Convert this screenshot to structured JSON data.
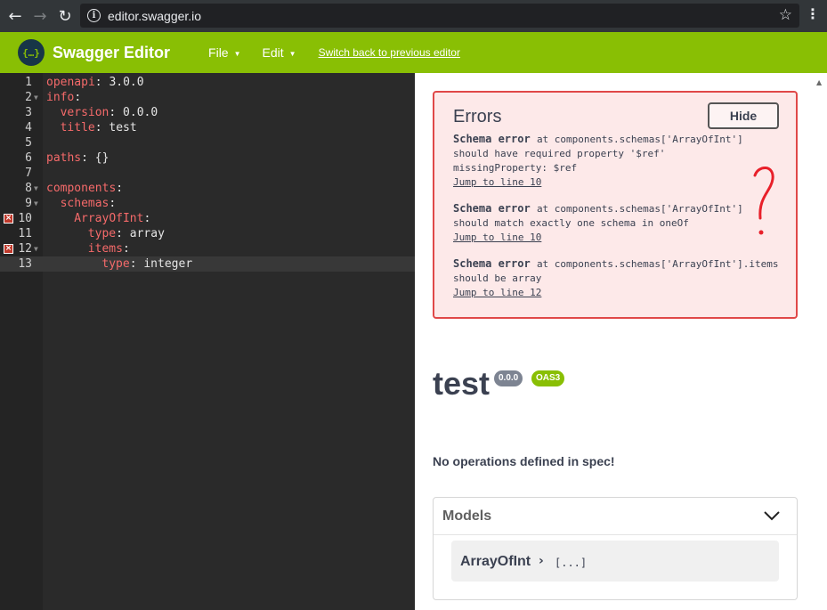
{
  "browser": {
    "url": "editor.swagger.io",
    "icons": {
      "back": "back-arrow-icon",
      "forward": "forward-arrow-icon",
      "reload": "reload-icon",
      "info": "info-icon",
      "star": "bookmark-star-icon",
      "menu": "browser-menu-icon"
    }
  },
  "topbar": {
    "logo_text": "{…}",
    "brand": "Swagger Editor",
    "file_menu": "File",
    "edit_menu": "Edit",
    "switch_link": "Switch back to previous editor",
    "bg_color": "#89bf04"
  },
  "editor": {
    "lines": [
      {
        "n": "1",
        "key": "openapi",
        "val": "3.0.0",
        "indent": 0
      },
      {
        "n": "2",
        "key": "info",
        "val": "",
        "indent": 0
      },
      {
        "n": "3",
        "key": "version",
        "val": "0.0.0",
        "indent": 1
      },
      {
        "n": "4",
        "key": "title",
        "val": "test",
        "indent": 1
      },
      {
        "n": "5",
        "key": "",
        "val": "",
        "indent": 0
      },
      {
        "n": "6",
        "key": "paths",
        "val": "{}",
        "indent": 0
      },
      {
        "n": "7",
        "key": "",
        "val": "",
        "indent": 0
      },
      {
        "n": "8",
        "key": "components",
        "val": "",
        "indent": 0
      },
      {
        "n": "9",
        "key": "schemas",
        "val": "",
        "indent": 1
      },
      {
        "n": "10",
        "key": "ArrayOfInt",
        "val": "",
        "indent": 2
      },
      {
        "n": "11",
        "key": "type",
        "val": "array",
        "indent": 3
      },
      {
        "n": "12",
        "key": "items",
        "val": "",
        "indent": 3
      },
      {
        "n": "13",
        "key": "type",
        "val": "integer",
        "indent": 4
      }
    ]
  },
  "errors": {
    "title": "Errors",
    "hide_label": "Hide",
    "items": [
      {
        "head": "Schema error",
        "loc": "at components.schemas['ArrayOfInt']",
        "msg1": "should have required property '$ref'",
        "msg2": "missingProperty: $ref",
        "jump": "Jump to line 10"
      },
      {
        "head": "Schema error",
        "loc": "at components.schemas['ArrayOfInt']",
        "msg1": "should match exactly one schema in oneOf",
        "msg2": "",
        "jump": "Jump to line 10"
      },
      {
        "head": "Schema error",
        "loc": "at components.schemas['ArrayOfInt'].items",
        "msg1": "should be array",
        "msg2": "",
        "jump": "Jump to line 12"
      }
    ]
  },
  "annotation": {
    "glyph": "?",
    "color": "#e8202a"
  },
  "info": {
    "title": "test",
    "version_badge": "0.0.0",
    "oas_badge": "OAS3",
    "no_ops": "No operations defined in spec!"
  },
  "models": {
    "title": "Models",
    "item_name": "ArrayOfInt",
    "item_arrow": "›",
    "item_more": "[...]"
  }
}
